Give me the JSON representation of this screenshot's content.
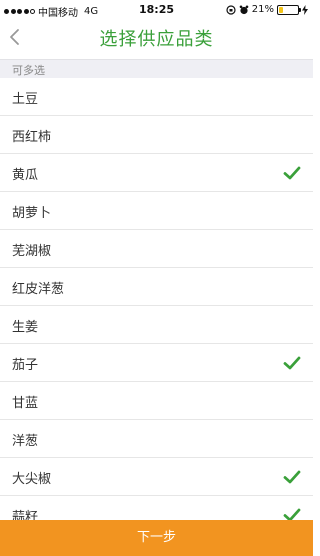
{
  "status_bar": {
    "carrier": "中国移动",
    "network": "4G",
    "time": "18:25",
    "battery_text": "21%",
    "battery_level": 0.21
  },
  "nav": {
    "back_icon": "chevron-left-icon",
    "title": "选择供应品类"
  },
  "section": {
    "header": "可多选"
  },
  "items": [
    {
      "label": "土豆",
      "selected": false
    },
    {
      "label": "西红柿",
      "selected": false
    },
    {
      "label": "黄瓜",
      "selected": true
    },
    {
      "label": "胡萝卜",
      "selected": false
    },
    {
      "label": "芜湖椒",
      "selected": false
    },
    {
      "label": "红皮洋葱",
      "selected": false
    },
    {
      "label": "生姜",
      "selected": false
    },
    {
      "label": "茄子",
      "selected": true
    },
    {
      "label": "甘蓝",
      "selected": false
    },
    {
      "label": "洋葱",
      "selected": false
    },
    {
      "label": "大尖椒",
      "selected": true
    },
    {
      "label": "蒜籽",
      "selected": true
    }
  ],
  "footer": {
    "next_label": "下一步"
  },
  "colors": {
    "accent_green": "#3aa03a",
    "footer_orange": "#f29420"
  }
}
